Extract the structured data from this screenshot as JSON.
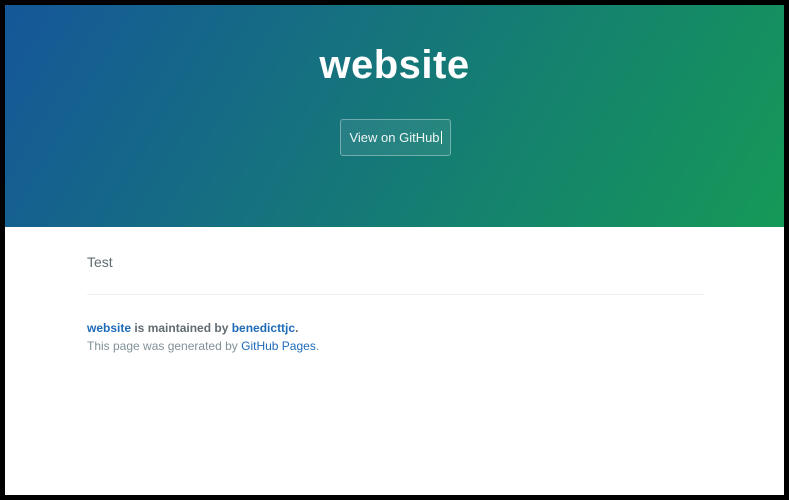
{
  "header": {
    "project_name": "website",
    "github_button_label": "View on GitHub"
  },
  "main": {
    "content_text": "Test"
  },
  "footer": {
    "owner_repo_link": "website",
    "maintained_by_text": " is maintained by ",
    "owner_link": "benedicttjc",
    "owner_suffix": ".",
    "credits_prefix": "This page was generated by ",
    "credits_link": "GitHub Pages",
    "credits_suffix": "."
  },
  "colors": {
    "header_gradient_start": "#155799",
    "header_gradient_end": "#159957",
    "link": "#1e6bb8",
    "text": "#606c71",
    "muted_text": "#819198"
  }
}
